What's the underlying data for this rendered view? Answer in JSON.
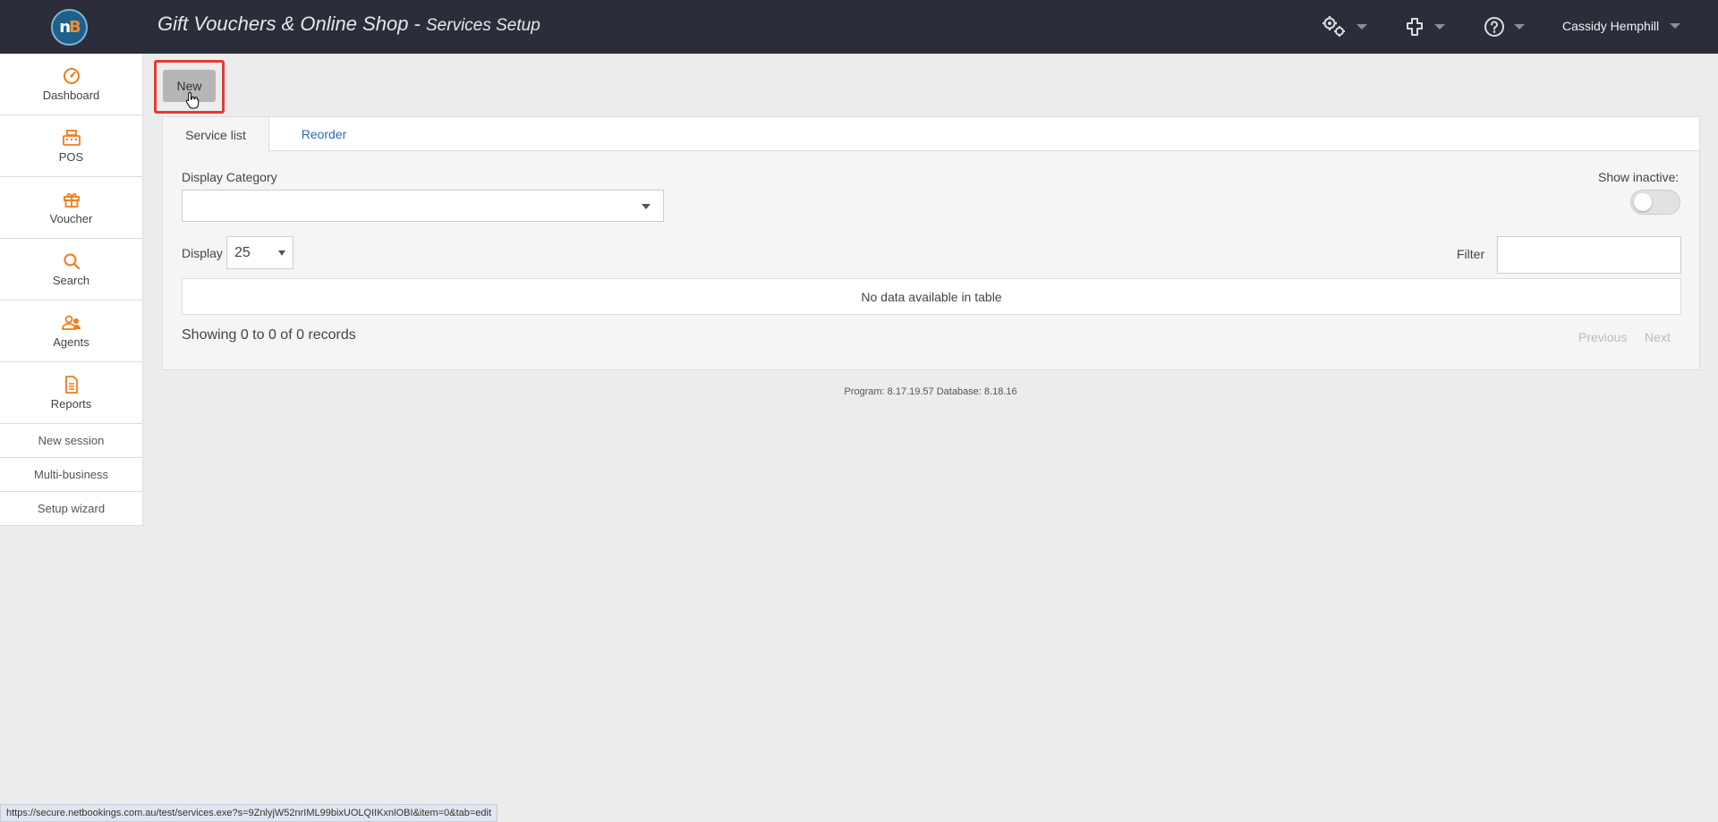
{
  "header": {
    "logo_text": "nB",
    "title": "Gift Vouchers & Online Shop - ",
    "subtitle": "Services Setup",
    "icons": [
      "settings-gears-icon",
      "plugins-icon",
      "help-icon"
    ],
    "user_name": "Cassidy Hemphill"
  },
  "sidebar": {
    "items": [
      {
        "label": "Dashboard",
        "icon": "dashboard-gauge-icon"
      },
      {
        "label": "POS",
        "icon": "cash-register-icon"
      },
      {
        "label": "Voucher",
        "icon": "gift-icon"
      },
      {
        "label": "Search",
        "icon": "search-icon"
      },
      {
        "label": "Agents",
        "icon": "agents-icon"
      },
      {
        "label": "Reports",
        "icon": "report-document-icon"
      }
    ],
    "links": [
      "New session",
      "Multi-business",
      "Setup wizard"
    ]
  },
  "toolbar": {
    "new_label": "New"
  },
  "tabs": [
    {
      "label": "Service list",
      "active": true
    },
    {
      "label": "Reorder",
      "active": false
    }
  ],
  "form": {
    "category_label": "Display Category",
    "category_value": "",
    "show_inactive_label": "Show inactive:",
    "show_inactive": false,
    "display_label": "Display",
    "display_value": "25",
    "filter_label": "Filter",
    "filter_value": ""
  },
  "table": {
    "empty_message": "No data available in table",
    "records_text": "Showing 0 to 0 of 0 records",
    "previous_label": "Previous",
    "next_label": "Next"
  },
  "footer": {
    "version": "Program: 8.17.19.57 Database: 8.18.16"
  },
  "status_bar": {
    "url": "https://secure.netbookings.com.au/test/services.exe?s=9ZnlyjW52nrIML99bixUOLQIIKxnlOBI&item=0&tab=edit"
  },
  "colors": {
    "topbar": "#2b2d3a",
    "accent": "#f07c1d",
    "link": "#2a6db5",
    "highlight": "#e53935"
  }
}
